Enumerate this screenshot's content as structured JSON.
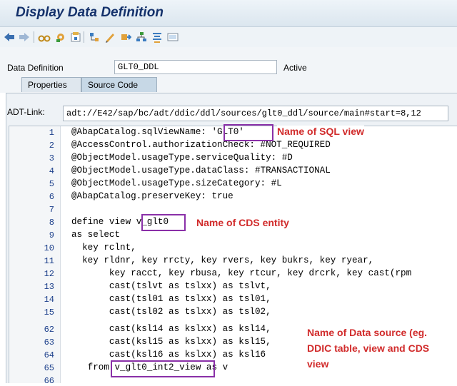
{
  "window": {
    "title": "Display Data Definition"
  },
  "toolbar": {
    "icons": [
      "back-arrow",
      "forward-arrow",
      "glasses",
      "settings",
      "object-list",
      "hierarchy",
      "pencil",
      "transport",
      "structure",
      "align",
      "display"
    ]
  },
  "header": {
    "data_definition_label": "Data Definition",
    "data_definition_value": "GLT0_DDL",
    "status": "Active"
  },
  "tabs": [
    {
      "label": "Properties"
    },
    {
      "label": "Source Code"
    }
  ],
  "adt": {
    "label": "ADT-Link:",
    "url": "adt://E42/sap/bc/adt/ddic/ddl/sources/glt0_ddl/source/main#start=8,12"
  },
  "editor": {
    "line_numbers": [
      "1",
      "2",
      "3",
      "4",
      "5",
      "6",
      "7",
      "8",
      "9",
      "10",
      "11",
      "12",
      "13",
      "14",
      "15",
      "62",
      "63",
      "64",
      "65",
      "66"
    ],
    "lines": [
      "@AbapCatalog.sqlViewName: 'GLT0'",
      "@AccessControl.authorizationCheck: #NOT_REQUIRED",
      "@ObjectModel.usageType.serviceQuality: #D",
      "@ObjectModel.usageType.dataClass: #TRANSACTIONAL",
      "@ObjectModel.usageType.sizeCategory: #L",
      "@AbapCatalog.preserveKey: true",
      "",
      "define view v_glt0",
      "as select",
      "  key rclnt,",
      "  key rldnr, key rrcty, key rvers, key bukrs, key ryear,",
      "       key racct, key rbusa, key rtcur, key drcrk, key cast(rpm",
      "       cast(tslvt as tslxx) as tslvt,",
      "       cast(tsl01 as tslxx) as tsl01,",
      "       cast(tsl02 as tslxx) as tsl02,",
      "       cast(ksl14 as kslxx) as ksl14,",
      "       cast(ksl15 as kslxx) as ksl15,",
      "       cast(ksl16 as kslxx) as ksl16",
      "   from v_glt0_int2_view as v",
      ""
    ]
  },
  "annotations": {
    "sql_view": "Name of SQL view",
    "cds_entity": "Name of CDS entity",
    "data_source_line1": "Name of Data source (eg.",
    "data_source_line2": "DDIC table, view and CDS",
    "data_source_line3": "view"
  },
  "colors": {
    "annotation_text": "#d12b2b",
    "highlight_box": "#8a30a8",
    "title_text": "#14316b"
  }
}
